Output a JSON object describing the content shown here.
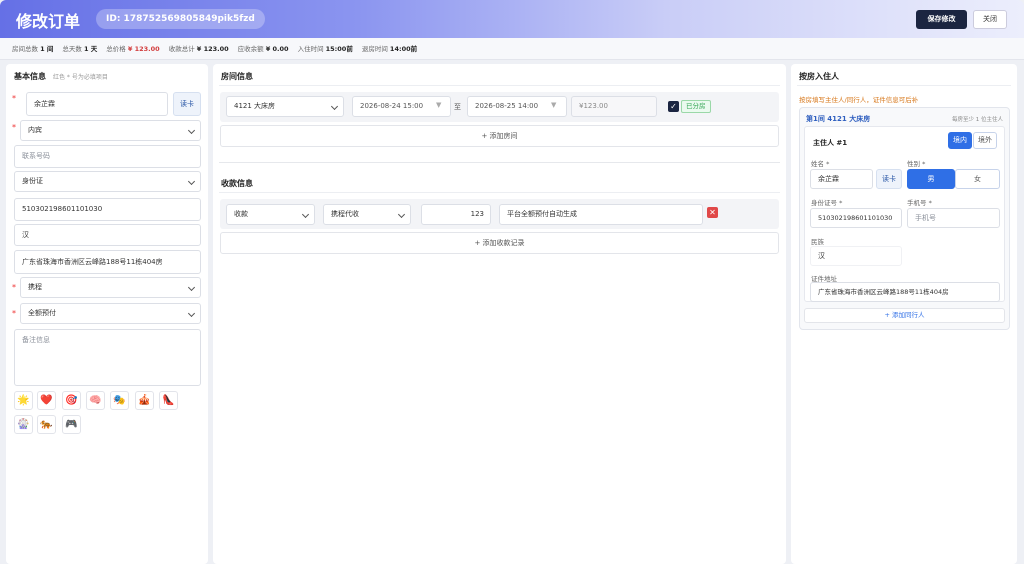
{
  "header": {
    "title": "修改订单",
    "order_id": "ID: 178752569805849pik5fzd",
    "save_label": "保存修改",
    "close_label": "关闭"
  },
  "summary": [
    {
      "label": "房间总数",
      "value": "1 间",
      "highlight": false
    },
    {
      "label": "总天数",
      "value": "1 天",
      "highlight": false
    },
    {
      "label": "总价格",
      "value": "¥ 123.00",
      "highlight": true
    },
    {
      "label": "收款总计",
      "value": "¥ 123.00",
      "highlight": false
    },
    {
      "label": "应收余额",
      "value": "¥ 0.00",
      "highlight": false
    },
    {
      "label": "入住时间",
      "value": "15:00前",
      "highlight": false
    },
    {
      "label": "退房时间",
      "value": "14:00前",
      "highlight": false
    }
  ],
  "basic": {
    "title": "基本信息",
    "hint": "红色 * 号为必填项目",
    "name": "余芷霖",
    "read_card": "读卡",
    "guest_type": "内宾",
    "phone_placeholder": "联系号码",
    "id_type": "身份证",
    "id_number": "510302198601101030",
    "ethnicity": "汉",
    "address": "广东省珠海市香洲区云峰路188号11栋404房",
    "channel": "携程",
    "payment": "全额预付",
    "remark_placeholder": "备注信息",
    "tags": [
      "🌟",
      "❤️",
      "🎯",
      "🧠",
      "🎭",
      "🎪",
      "👠",
      "🎡",
      "🐅",
      "🎮"
    ]
  },
  "rooms": {
    "title": "房间信息",
    "room": "4121 大床房",
    "checkin": "2026-08-24 15:00",
    "to": "至",
    "checkout": "2026-08-25 14:00",
    "price": "¥123.00",
    "assigned": "已分房",
    "add_room": "+ 添加房间"
  },
  "payments": {
    "title": "收款信息",
    "type": "收款",
    "method": "携程代收",
    "amount": "123",
    "note": "平台全额预付自动生成",
    "add_payment": "+ 添加收款记录"
  },
  "guests": {
    "title": "按房入住人",
    "warning": "按房填写主住人/同行人，证件信息可后补",
    "room_label": "第1间 4121 大床房",
    "min_note": "每房至少 1 位主住人",
    "main_label": "主住人 #1",
    "domestic": "境内",
    "foreign": "境外",
    "name_label": "姓名 *",
    "name": "余芷霖",
    "read_card": "读卡",
    "gender_label": "性别 *",
    "male": "男",
    "female": "女",
    "id_label": "身份证号 *",
    "id_number": "510302198601101030",
    "phone_label": "手机号 *",
    "phone_placeholder": "手机号",
    "ethnicity_label": "民族",
    "ethnicity": "汉",
    "address_label": "证件地址",
    "address": "广东省珠海市香洲区云峰路188号11栋404房",
    "add_companion": "+ 添加同行人"
  },
  "colors": {
    "accent": "#1b2541",
    "header_gradient_start": "#6570e6",
    "required": "#e33333",
    "warning": "#d7771a",
    "active_blue": "#2f6fe6",
    "assigned_green": "#2ea44f",
    "delete_red": "#e04848"
  }
}
